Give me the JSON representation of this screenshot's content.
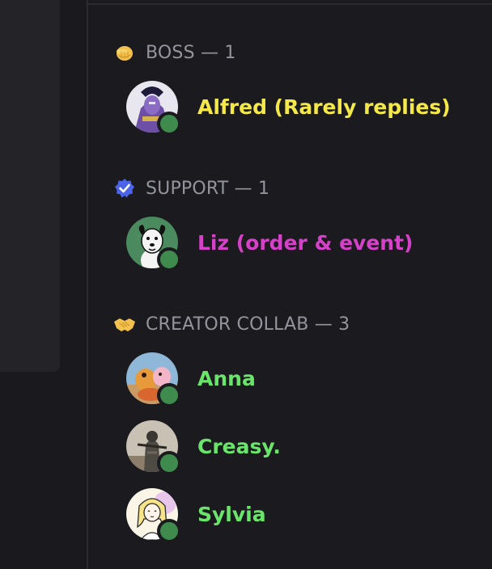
{
  "groups": [
    {
      "header": "BOSS — 1",
      "icon": "pointing-hand-icon",
      "members": [
        {
          "name": "Alfred (Rarely replies)",
          "color": "#f5e94a",
          "status": "online",
          "avatar": "purple-deity-avatar"
        }
      ]
    },
    {
      "header": "SUPPORT — 1",
      "icon": "verified-badge-icon",
      "members": [
        {
          "name": "Liz (order & event)",
          "color": "#d541c8",
          "status": "online",
          "avatar": "white-dog-avatar"
        }
      ]
    },
    {
      "header": "CREATOR COLLAB — 3",
      "icon": "handshake-icon",
      "members": [
        {
          "name": "Anna",
          "color": "#6be46b",
          "status": "online",
          "avatar": "cartoon-animals-avatar"
        },
        {
          "name": "Creasy.",
          "color": "#6be46b",
          "status": "online",
          "avatar": "armored-knight-avatar"
        },
        {
          "name": "Sylvia",
          "color": "#6be46b",
          "status": "online",
          "avatar": "drawn-girl-avatar"
        }
      ]
    }
  ],
  "colors": {
    "background": "#1b1b1f",
    "header_text": "#94949c",
    "online": "#3f8b4e"
  }
}
